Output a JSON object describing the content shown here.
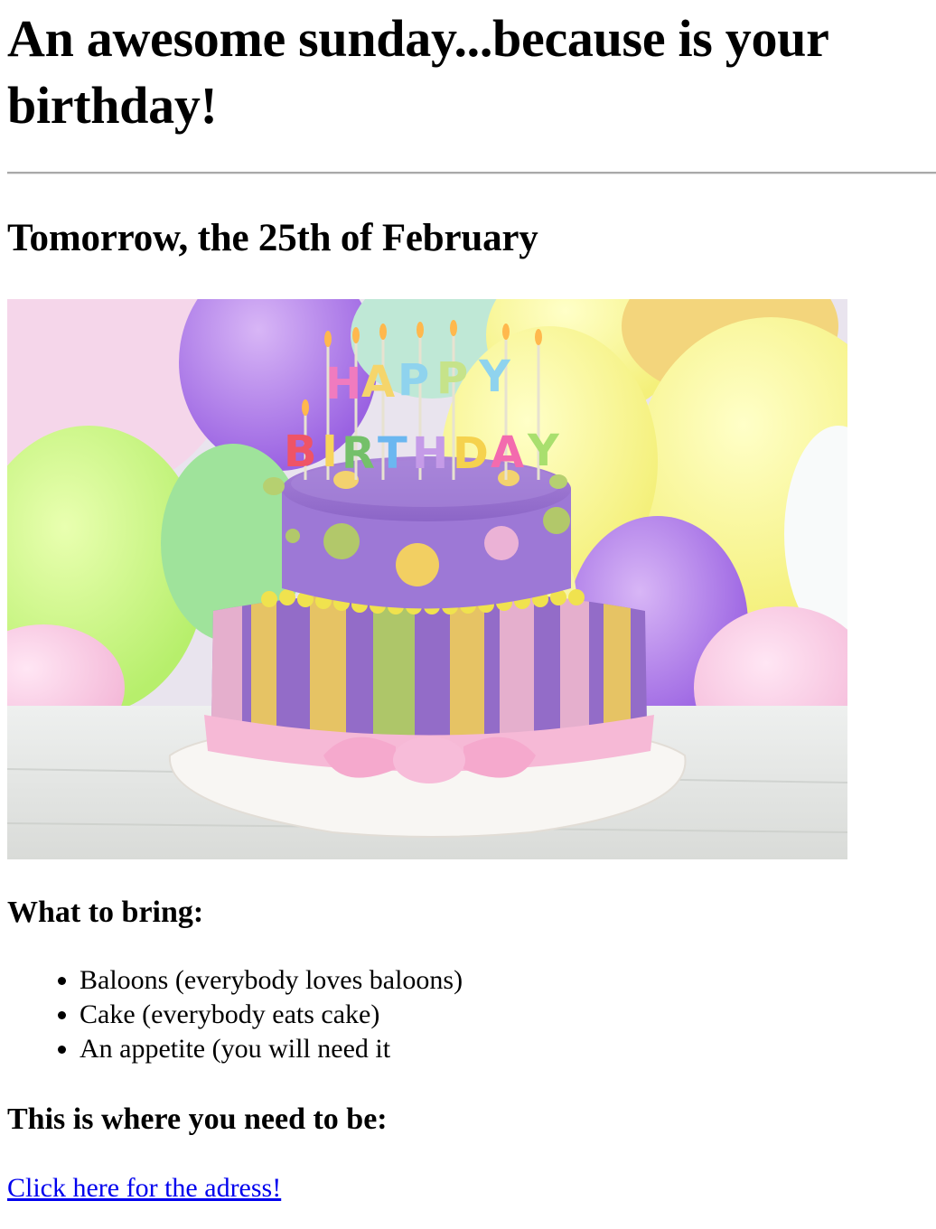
{
  "page": {
    "title": "An awesome sunday...because is your birthday!",
    "date_heading": "Tomorrow, the 25th of February",
    "bring_heading": "What to bring:",
    "bring_items": [
      "Baloons (everybody loves baloons)",
      "Cake (everybody eats cake)",
      "An appetite (you will need it"
    ],
    "cake_candles_text": "HAPPY BIRTHDAY",
    "where_heading": "This is where you need to be:",
    "address_link": "Click here for the adress!"
  },
  "colors": {
    "link": "#0000ee",
    "rule": "#a9a9a9"
  }
}
